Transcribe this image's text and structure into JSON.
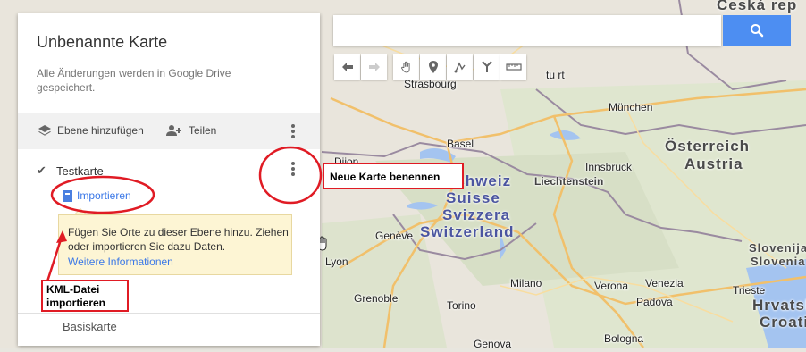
{
  "map": {
    "cities": [
      "Strasbourg",
      "München",
      "Basel",
      "Dijon",
      "Innsbruck",
      "Liechtenstein",
      "Genève",
      "Lyon",
      "Grenoble",
      "Milano",
      "Torino",
      "Verona",
      "Venezia",
      "Padova",
      "Trieste",
      "Bologna",
      "Genova"
    ],
    "countries": {
      "ceska": "Česká rep",
      "osterreich": "Österreich",
      "austria": "Austria",
      "schweiz": "Schweiz",
      "suisse": "Suisse",
      "svizzera": "Svizzera",
      "switzerland": "Switzerland",
      "slovenija": "Slovenija",
      "slovenia": "Slovenia",
      "hrvatska": "Hrvatsk",
      "croatia": "Croati"
    },
    "partial_labels": {
      "stuttgart": "tu    rt"
    }
  },
  "panel": {
    "title": "Unbenannte Karte",
    "save_note": "Alle Änderungen werden in Google Drive gespeichert.",
    "add_layer_label": "Ebene hinzufügen",
    "share_label": "Teilen",
    "layer_name": "Testkarte",
    "import_label": "Importieren",
    "tooltip_text": "Fügen Sie Orte zu dieser Ebene hinzu. Ziehen oder importieren Sie dazu Daten.",
    "tooltip_link": "Weitere Informationen",
    "basemap_label": "Basiskarte"
  },
  "search": {
    "placeholder": "",
    "icon": "search-icon"
  },
  "toolbar": {
    "tools": [
      "undo-icon",
      "redo-icon",
      "hand-icon",
      "marker-icon",
      "draw-line-icon",
      "directions-icon",
      "ruler-icon"
    ]
  },
  "annotations": {
    "kml_callout": "KML-Datei importieren",
    "rename_callout": "Neue Karte benennen"
  },
  "colors": {
    "accent_blue": "#4d8ef2",
    "annotation_red": "#e01b24",
    "tooltip_bg": "#fdf5d4"
  }
}
